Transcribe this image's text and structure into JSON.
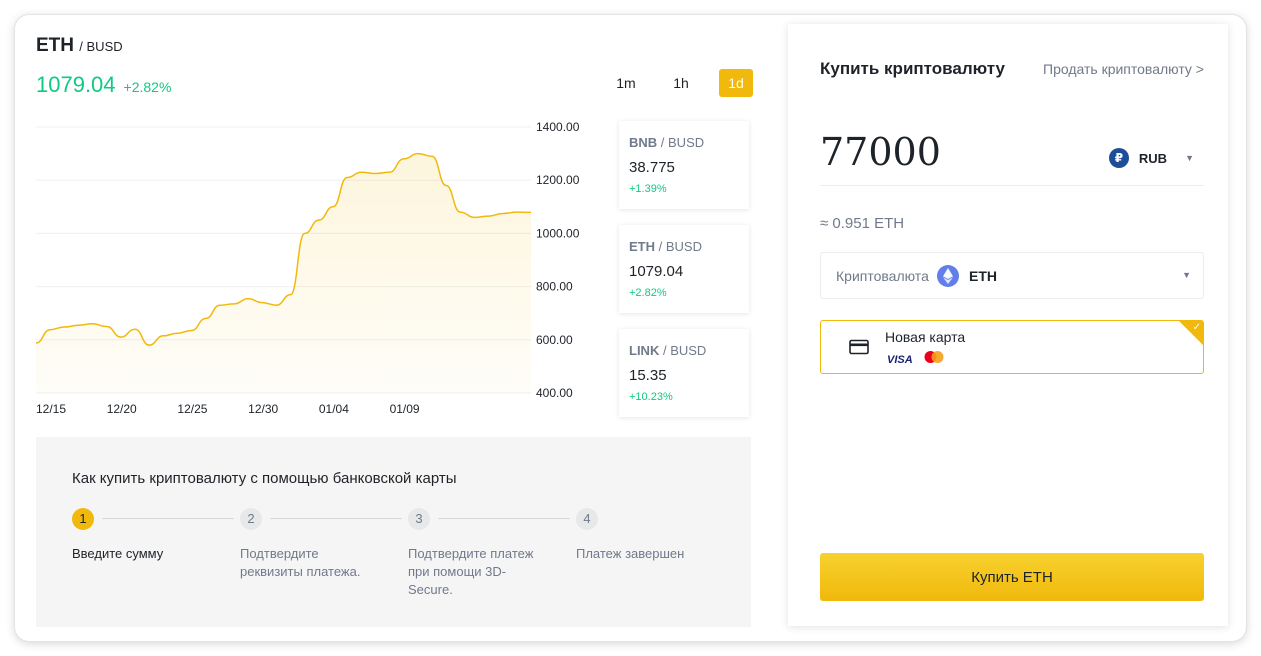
{
  "ticker": {
    "base": "ETH",
    "quote": "BUSD",
    "price": "1079.04",
    "change": "+2.82%"
  },
  "timeframes": [
    {
      "label": "1m"
    },
    {
      "label": "1h"
    },
    {
      "label": "1d",
      "active": true
    }
  ],
  "chart_data": {
    "type": "area",
    "x_ticks": [
      "12/15",
      "12/20",
      "12/25",
      "12/30",
      "01/04",
      "01/09"
    ],
    "y_ticks": [
      "1400.00",
      "1200.00",
      "1000.00",
      "800.00",
      "600.00",
      "400.00"
    ],
    "ylim": [
      400,
      1400
    ],
    "x_days": [
      0,
      1,
      2,
      3,
      4,
      5,
      6,
      7,
      8,
      9,
      10,
      11,
      12,
      13,
      14,
      15,
      16,
      17,
      18,
      19,
      20,
      21,
      22,
      23,
      24,
      25,
      26,
      27,
      28,
      29,
      30,
      31,
      32,
      33,
      34,
      35
    ],
    "values": [
      588,
      638,
      648,
      655,
      660,
      650,
      610,
      640,
      580,
      615,
      625,
      635,
      680,
      730,
      735,
      755,
      740,
      730,
      770,
      1000,
      1050,
      1100,
      1210,
      1230,
      1225,
      1230,
      1280,
      1300,
      1290,
      1180,
      1080,
      1060,
      1065,
      1075,
      1080,
      1079
    ],
    "line_color": "#f0b90b",
    "grid": true
  },
  "market_cards": [
    {
      "base": "BNB",
      "quote": "BUSD",
      "price": "38.775",
      "change": "+1.39%"
    },
    {
      "base": "ETH",
      "quote": "BUSD",
      "price": "1079.04",
      "change": "+2.82%"
    },
    {
      "base": "LINK",
      "quote": "BUSD",
      "price": "15.35",
      "change": "+10.23%"
    }
  ],
  "howto": {
    "title": "Как купить криптовалюту с помощью банковской карты",
    "steps": [
      {
        "num": "1",
        "text": "Введите сумму"
      },
      {
        "num": "2",
        "text": "Подтвердите реквизиты платежа."
      },
      {
        "num": "3",
        "text": "Подтвердите платеж при помощи 3D-Secure."
      },
      {
        "num": "4",
        "text": "Платеж завершен"
      }
    ]
  },
  "buy_panel": {
    "title": "Купить криптовалюту",
    "sell_link": "Продать криптовалюту >",
    "amount": "77000",
    "fiat": "RUB",
    "fiat_symbol": "₽",
    "approx": "≈ 0.951 ETH",
    "crypto_label": "Криптовалюта",
    "crypto_value": "ETH",
    "card_name": "Новая карта",
    "card_brand": "VISA",
    "buy_button": "Купить ETH"
  },
  "colors": {
    "accent": "#f0b90b",
    "up": "#0ecb81",
    "text": "#1e2329",
    "muted": "#707a8a"
  },
  "icons": {
    "fiat": "ruble-icon",
    "crypto": "ethereum-icon",
    "card": "credit-card-icon",
    "mastercard": "mastercard-icon",
    "selected": "check-icon"
  }
}
